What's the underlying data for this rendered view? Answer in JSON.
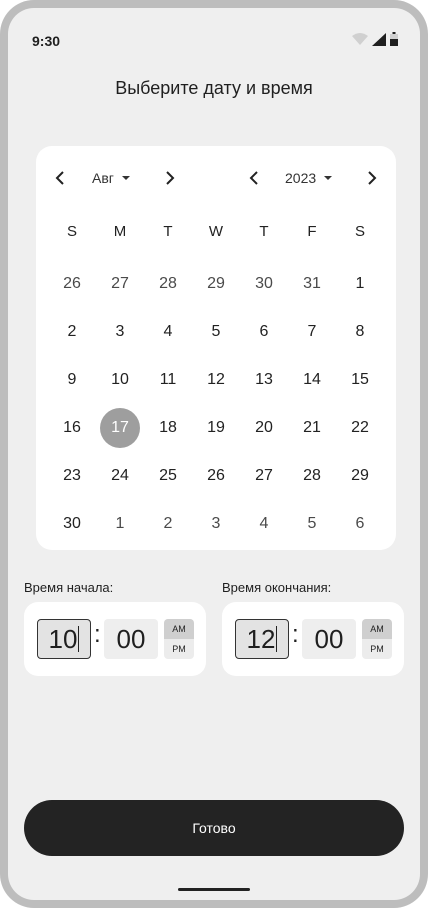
{
  "status_bar": {
    "time": "9:30",
    "icons": [
      "wifi-icon",
      "signal-icon",
      "battery-icon"
    ]
  },
  "title": "Выберите дату и время",
  "calendar": {
    "month": "Авг",
    "year": "2023",
    "weekdays": [
      "S",
      "M",
      "T",
      "W",
      "T",
      "F",
      "S"
    ],
    "days": [
      {
        "label": "26",
        "muted": true
      },
      {
        "label": "27",
        "muted": true
      },
      {
        "label": "28",
        "muted": true
      },
      {
        "label": "29",
        "muted": true
      },
      {
        "label": "30",
        "muted": true
      },
      {
        "label": "31",
        "muted": true
      },
      {
        "label": "1"
      },
      {
        "label": "2"
      },
      {
        "label": "3"
      },
      {
        "label": "4"
      },
      {
        "label": "5"
      },
      {
        "label": "6"
      },
      {
        "label": "7"
      },
      {
        "label": "8"
      },
      {
        "label": "9"
      },
      {
        "label": "10"
      },
      {
        "label": "11"
      },
      {
        "label": "12"
      },
      {
        "label": "13"
      },
      {
        "label": "14"
      },
      {
        "label": "15"
      },
      {
        "label": "16"
      },
      {
        "label": "17",
        "selected": true
      },
      {
        "label": "18"
      },
      {
        "label": "19"
      },
      {
        "label": "20"
      },
      {
        "label": "21"
      },
      {
        "label": "22"
      },
      {
        "label": "23"
      },
      {
        "label": "24"
      },
      {
        "label": "25"
      },
      {
        "label": "26"
      },
      {
        "label": "27"
      },
      {
        "label": "28"
      },
      {
        "label": "29"
      },
      {
        "label": "30"
      },
      {
        "label": "1",
        "muted": true
      },
      {
        "label": "2",
        "muted": true
      },
      {
        "label": "3",
        "muted": true
      },
      {
        "label": "4",
        "muted": true
      },
      {
        "label": "5",
        "muted": true
      },
      {
        "label": "6",
        "muted": true
      }
    ]
  },
  "start_time": {
    "label": "Время начала:",
    "hour": "10",
    "minute": "00",
    "am": "AM",
    "pm": "PM"
  },
  "end_time": {
    "label": "Время окончания:",
    "hour": "12",
    "minute": "00",
    "am": "AM",
    "pm": "PM"
  },
  "done_button": "Готово",
  "colors": {
    "accent": "#232323",
    "selected_day": "#9e9e9e",
    "background": "#efefef"
  }
}
